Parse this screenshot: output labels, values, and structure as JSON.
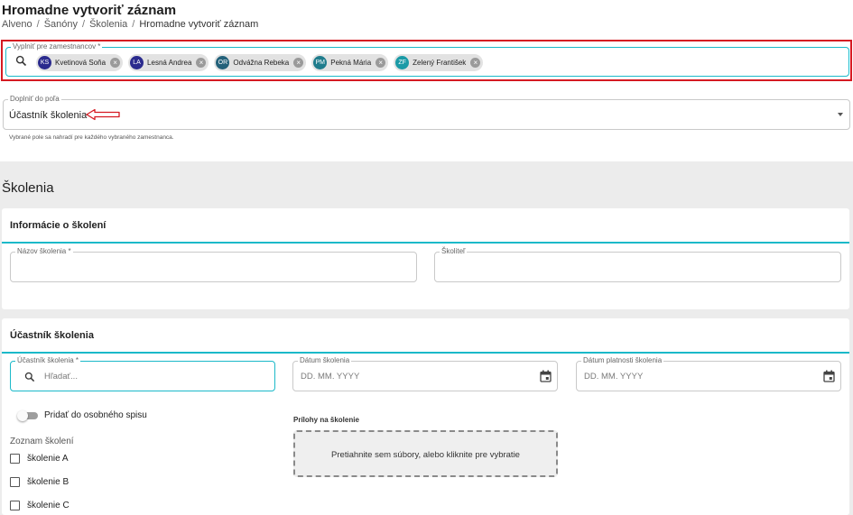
{
  "header": {
    "title": "Hromadne vytvoriť záznam",
    "breadcrumbs": [
      "Alveno",
      "Šanóny",
      "Školenia",
      "Hromadne vytvoriť záznam"
    ]
  },
  "employees_field": {
    "label": "Vyplniť pre zamestnancov *",
    "chips": [
      {
        "initials": "KS",
        "name": "Kvetinová Soňa",
        "color": "#2b2b8e"
      },
      {
        "initials": "LA",
        "name": "Lesná Andrea",
        "color": "#2b2b8e"
      },
      {
        "initials": "OR",
        "name": "Odvážna Rebeka",
        "color": "#23617a"
      },
      {
        "initials": "PM",
        "name": "Pekná Mária",
        "color": "#1f7c8c"
      },
      {
        "initials": "ZF",
        "name": "Zelený František",
        "color": "#1a9aa6"
      }
    ]
  },
  "fill_field": {
    "label": "Doplniť do poľa",
    "value": "Účastník školenia",
    "helper": "Vybrané pole sa nahradí pre každého vybraného zamestnanca."
  },
  "section_title": "Školenia",
  "info_card": {
    "title": "Informácie o školení",
    "name_label": "Názov školenia *",
    "trainer_label": "Školiteľ"
  },
  "participant_card": {
    "title": "Účastník školenia",
    "participant_label": "Účastník školenia *",
    "participant_placeholder": "Hľadať...",
    "date_label": "Dátum školenia",
    "date_placeholder": "DD. MM. YYYY",
    "validity_label": "Dátum platnosti školenia",
    "validity_placeholder": "DD. MM. YYYY",
    "toggle_label": "Pridať do osobného spisu",
    "list_title": "Zoznam školení",
    "trainings": [
      "školenie A",
      "školenie B",
      "školenie C"
    ],
    "attachments_label": "Prílohy na školenie",
    "dropzone_text": "Pretiahnite sem súbory, alebo kliknite pre vybratie"
  },
  "colors": {
    "accent": "#1bb9c9",
    "highlight": "#d51a22"
  }
}
